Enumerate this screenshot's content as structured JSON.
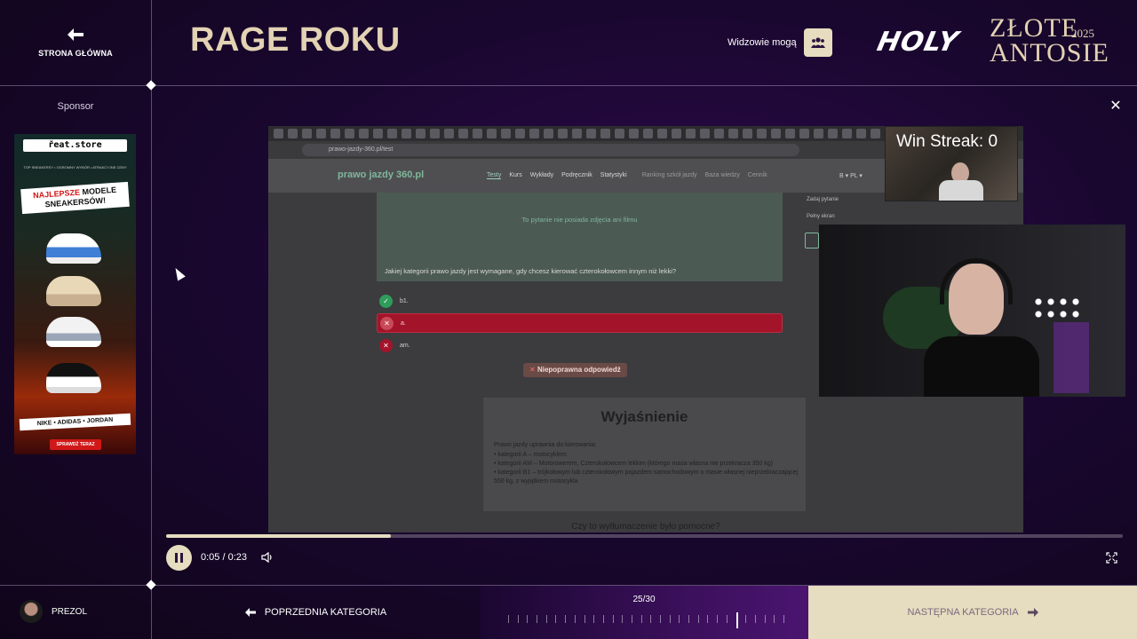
{
  "header": {
    "home_label": "STRONA GŁÓWNA",
    "title": "RAGE ROKU",
    "viewers_label": "Widzowie mogą",
    "viewers_icon": "users-icon",
    "brand_holy": "HOLY",
    "brand_zlote": "ZŁOTE",
    "brand_antosie": "ANTOSIE",
    "brand_year": "2025"
  },
  "sponsor": {
    "label": "Sponsor",
    "ad": {
      "store": "řeat.store",
      "tagline": "TOP SNEAKERSY • OGROMNY WYBÓR • ATRAKCYJNE CENY",
      "headline_line1": "NAJLEPSZE",
      "headline_line1b": "MODELE",
      "headline_line2": "SNEAKERSÓW!",
      "brands": "NIKE • ADIDAS • JORDAN",
      "cta": "SPRAWDŹ TERAZ"
    }
  },
  "video": {
    "url": "prawo-jazdy-360.pl/test",
    "site_logo": "prawo jazdy 360.pl",
    "nav": [
      "Testy",
      "Kurs",
      "Wykłady",
      "Podręcznik",
      "Statystyki"
    ],
    "nav_dim": [
      "Ranking szkół jazdy",
      "Baza wiedzy",
      "Cennik"
    ],
    "lang": "B ▾   PL ▾",
    "no_media": "To pytanie nie posiada zdjęcia ani filmu",
    "question": "Jakiej kategorii prawo jazdy jest wymagane, gdy chcesz kierować czterokołowcem innym niż lekki?",
    "answers": [
      {
        "label": "b1.",
        "state": "correct"
      },
      {
        "label": "a.",
        "state": "wrong-selected"
      },
      {
        "label": "am.",
        "state": "wrong"
      }
    ],
    "result": "Niepoprawna odpowiedź",
    "side_tools": [
      "Zadaj pytanie",
      "Pełny ekran"
    ],
    "explanation_title": "Wyjaśnienie",
    "explanation_intro": "Prawo jazdy uprawnia do kierowania:",
    "explanation_items": [
      "kategorii A – motocyklem",
      "kategorii AM – Motorowerem, Czterokołowcem lekkim (którego masa własna nie przekracza 350 kg)",
      "kategorii B1 – trójkołowym lub czterokołowym pojazdem samochodowym o masie własnej nieprzekraczającej 550 kg, z wyjątkiem motocykla"
    ],
    "helpful": "Czy to wytłumaczenie było pomocne?",
    "win_streak": "Win Streak: 0"
  },
  "player": {
    "time": "0:05 / 0:23",
    "progress": 0.235
  },
  "footer": {
    "user_name": "PREZOL",
    "prev_label": "POPRZEDNIA KATEGORIA",
    "counter": "25/30",
    "current_index": 25,
    "total": 30,
    "next_label": "NASTĘPNA KATEGORIA"
  },
  "colors": {
    "accent_gold": "#e3d2b3",
    "button_bg": "#e6dcbf",
    "wrong": "#a3142a",
    "correct": "#2e9c5a"
  }
}
